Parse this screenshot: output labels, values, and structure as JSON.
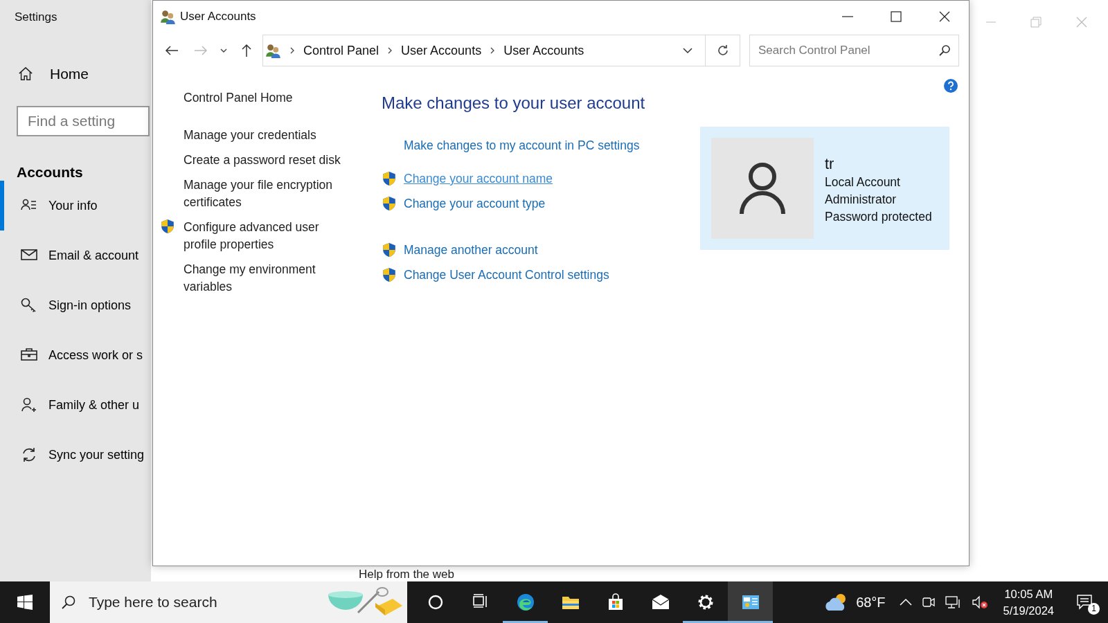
{
  "settings": {
    "title": "Settings",
    "home": "Home",
    "search": {
      "placeholder": "Find a setting"
    },
    "section": "Accounts",
    "nav": [
      {
        "label": "Your info",
        "selected": true
      },
      {
        "label": "Email & account",
        "selected": false
      },
      {
        "label": "Sign-in options",
        "selected": false
      },
      {
        "label": "Access work or s",
        "selected": false
      },
      {
        "label": "Family & other u",
        "selected": false
      },
      {
        "label": "Sync your setting",
        "selected": false
      }
    ],
    "help_heading": "Help from the web"
  },
  "window": {
    "title": "User Accounts",
    "breadcrumb": [
      "Control Panel",
      "User Accounts",
      "User Accounts"
    ],
    "search": {
      "placeholder": "Search Control Panel"
    },
    "sidebar": {
      "home": "Control Panel Home",
      "items": [
        {
          "label": "Manage your credentials",
          "shield": false
        },
        {
          "label": "Create a password reset disk",
          "shield": false
        },
        {
          "label": "Manage your file encryption certificates",
          "shield": false
        },
        {
          "label": "Configure advanced user profile properties",
          "shield": true
        },
        {
          "label": "Change my environment variables",
          "shield": false
        }
      ]
    },
    "heading": "Make changes to your user account",
    "link_groups": [
      [
        {
          "label": "Make changes to my account in PC settings",
          "shield": false,
          "hover": false
        }
      ],
      [
        {
          "label": "Change your account name",
          "shield": true,
          "hover": true
        },
        {
          "label": "Change your account type",
          "shield": true,
          "hover": false
        }
      ],
      [
        {
          "label": "Manage another account",
          "shield": true,
          "hover": false
        },
        {
          "label": "Change User Account Control settings",
          "shield": true,
          "hover": false
        }
      ]
    ],
    "account": {
      "name": "tr",
      "lines": [
        "Local Account",
        "Administrator",
        "Password protected"
      ]
    }
  },
  "taskbar": {
    "search": {
      "placeholder": "Type here to search"
    },
    "apps": [
      {
        "kind": "cortana",
        "running": false,
        "selected": false
      },
      {
        "kind": "taskview",
        "running": false,
        "selected": false
      },
      {
        "kind": "edge",
        "running": true,
        "selected": false
      },
      {
        "kind": "explorer",
        "running": false,
        "selected": false
      },
      {
        "kind": "store",
        "running": false,
        "selected": false
      },
      {
        "kind": "mail",
        "running": false,
        "selected": false
      },
      {
        "kind": "settings",
        "running": true,
        "selected": false
      },
      {
        "kind": "controlpanel",
        "running": true,
        "selected": true
      }
    ],
    "weather": "68°F",
    "time": "10:05 AM",
    "date": "5/19/2024",
    "notifications": "1"
  }
}
